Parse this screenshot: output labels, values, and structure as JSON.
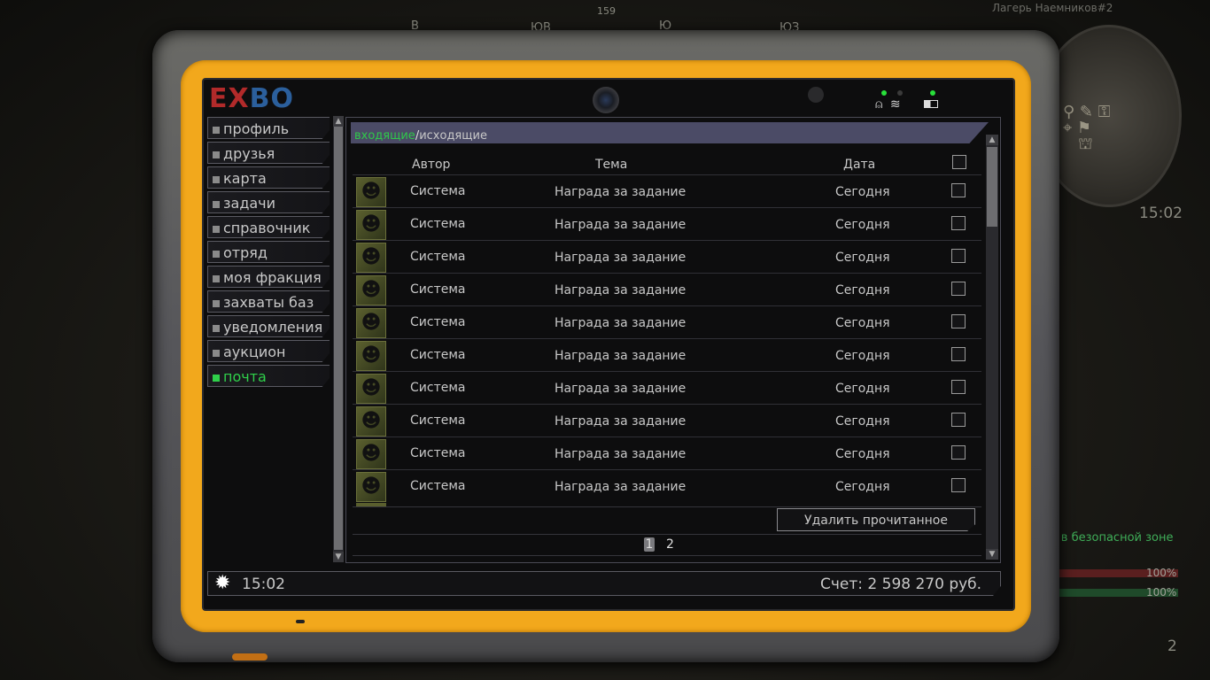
{
  "hud": {
    "compass": [
      "В",
      "ЮВ",
      "159",
      "Ю",
      "ЮЗ"
    ],
    "location": "Лагерь Наемников#2",
    "time": "15:02",
    "safe_zone": "ь в безопасной зоне",
    "bar1_pct": "100%",
    "bar2_pct": "100%",
    "item_count": "2"
  },
  "tablet": {
    "logo_part1": "EX",
    "logo_part2": "BO",
    "sidebar": {
      "items": [
        {
          "label": "профиль"
        },
        {
          "label": "друзья"
        },
        {
          "label": "карта"
        },
        {
          "label": "задачи"
        },
        {
          "label": "справочник"
        },
        {
          "label": "отряд"
        },
        {
          "label": "моя фракция"
        },
        {
          "label": "захваты баз"
        },
        {
          "label": "уведомления"
        },
        {
          "label": "аукцион"
        },
        {
          "label": "почта",
          "active": true
        }
      ]
    },
    "mail": {
      "tab_incoming": "входящие",
      "tab_sep": "/",
      "tab_outgoing": "исходящие",
      "columns": {
        "author": "Автор",
        "subject": "Тема",
        "date": "Дата"
      },
      "rows": [
        {
          "author": "Система",
          "subject": "Награда за задание",
          "date": "Сегодня"
        },
        {
          "author": "Система",
          "subject": "Награда за задание",
          "date": "Сегодня"
        },
        {
          "author": "Система",
          "subject": "Награда за задание",
          "date": "Сегодня"
        },
        {
          "author": "Система",
          "subject": "Награда за задание",
          "date": "Сегодня"
        },
        {
          "author": "Система",
          "subject": "Награда за задание",
          "date": "Сегодня"
        },
        {
          "author": "Система",
          "subject": "Награда за задание",
          "date": "Сегодня"
        },
        {
          "author": "Система",
          "subject": "Награда за задание",
          "date": "Сегодня"
        },
        {
          "author": "Система",
          "subject": "Награда за задание",
          "date": "Сегодня"
        },
        {
          "author": "Система",
          "subject": "Награда за задание",
          "date": "Сегодня"
        },
        {
          "author": "Система",
          "subject": "Награда за задание",
          "date": "Сегодня"
        }
      ],
      "delete_read_label": "Удалить прочитанное",
      "pages": [
        "1",
        "2"
      ],
      "current_page": "1"
    },
    "footer": {
      "time": "15:02",
      "balance": "Счет: 2 598 270 руб."
    }
  },
  "colors": {
    "accent_green": "#2fd04a",
    "frame_orange": "#f2a81c",
    "tab_bar": "#4b4b66"
  }
}
